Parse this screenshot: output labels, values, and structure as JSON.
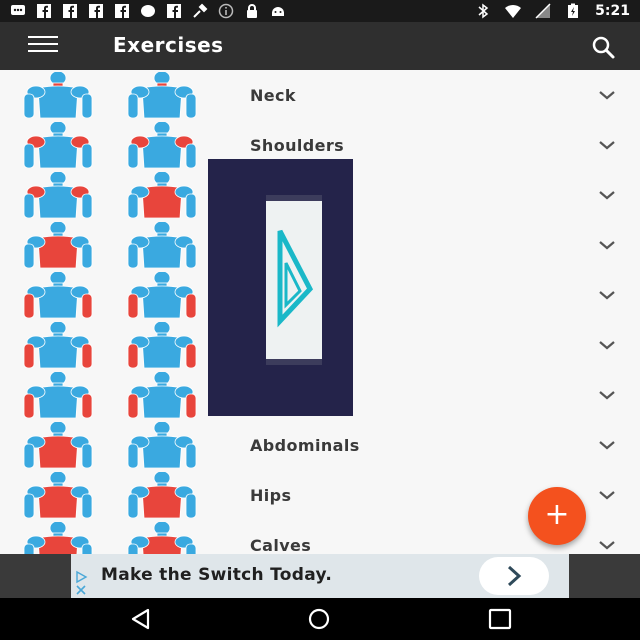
{
  "status_bar": {
    "time": "5:21",
    "icons": [
      "chat-icon",
      "facebook-icon",
      "facebook-icon",
      "facebook-icon",
      "facebook-icon",
      "circle-icon",
      "facebook-icon",
      "tools-icon",
      "info-icon",
      "lock-icon",
      "android-icon",
      "bluetooth-icon",
      "wifi-icon",
      "signal-icon",
      "battery-icon"
    ]
  },
  "app_bar": {
    "title": "Exercises",
    "menu_icon": "hamburger-menu-icon",
    "search_icon": "search-icon"
  },
  "exercises": [
    {
      "label": "Neck",
      "highlight": "neck"
    },
    {
      "label": "Shoulders",
      "highlight": "shoulders"
    },
    {
      "label": "",
      "highlight": "upper-back"
    },
    {
      "label": "",
      "highlight": "chest"
    },
    {
      "label": "",
      "highlight": "biceps"
    },
    {
      "label": "",
      "highlight": "triceps"
    },
    {
      "label": "",
      "highlight": "forearms"
    },
    {
      "label": "Abdominals",
      "highlight": "abdominals"
    },
    {
      "label": "Hips",
      "highlight": "hips"
    },
    {
      "label": "Calves",
      "highlight": "calves"
    }
  ],
  "fab": {
    "label": "+"
  },
  "ad": {
    "text": "Make the Switch Today."
  },
  "colors": {
    "muscle_blue": "#3aa9e0",
    "muscle_red": "#e8453c",
    "fab": "#f4511e",
    "app_bar": "#2f2f2f"
  }
}
